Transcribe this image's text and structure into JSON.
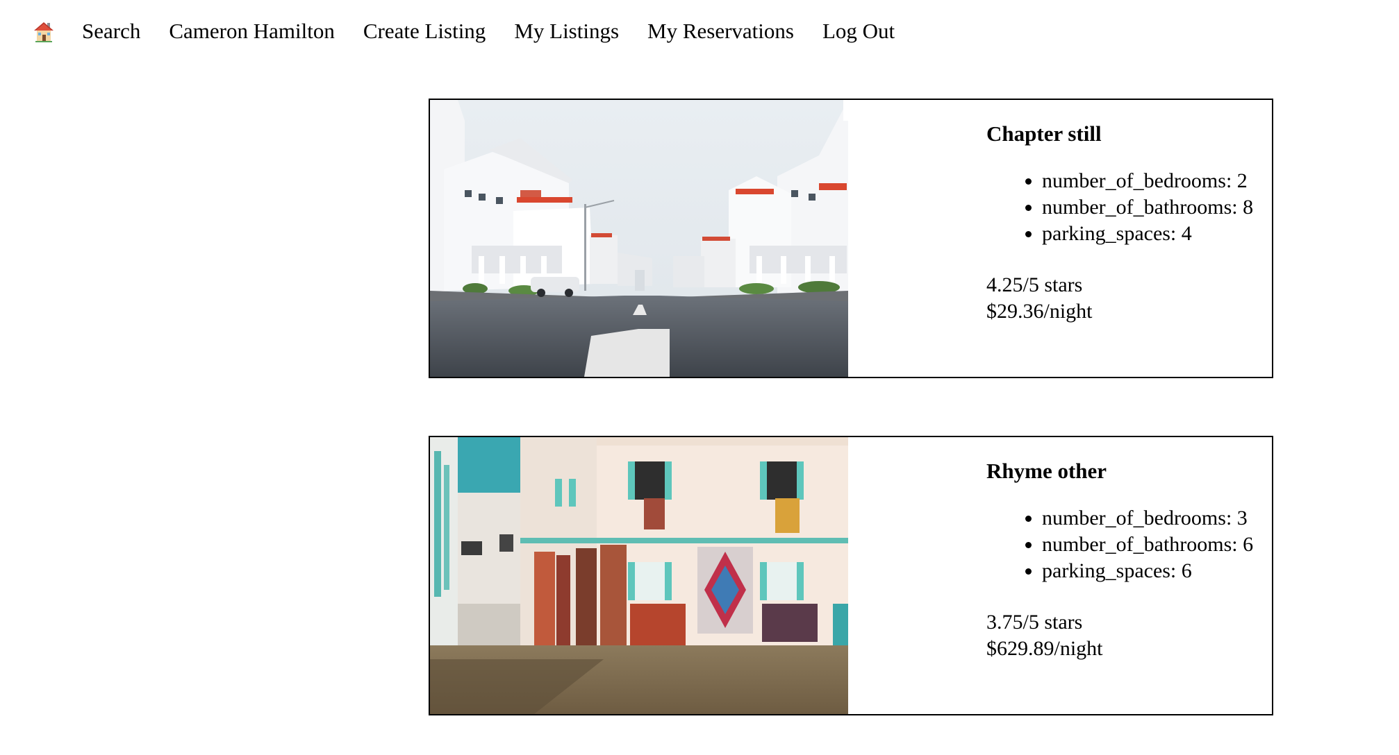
{
  "nav": {
    "home_icon": "house-emoji-icon",
    "items": [
      {
        "label": "Search"
      },
      {
        "label": "Cameron Hamilton"
      },
      {
        "label": "Create Listing"
      },
      {
        "label": "My Listings"
      },
      {
        "label": "My Reservations"
      },
      {
        "label": "Log Out"
      }
    ]
  },
  "listings": [
    {
      "title": "Chapter still",
      "image": "street-with-white-villas-photo",
      "features": [
        "number_of_bedrooms: 2",
        "number_of_bathrooms: 8",
        "parking_spaces: 4"
      ],
      "rating": "4.25/5 stars",
      "price": "$29.36/night"
    },
    {
      "title": "Rhyme other",
      "image": "white-building-with-rugs-photo",
      "features": [
        "number_of_bedrooms: 3",
        "number_of_bathrooms: 6",
        "parking_spaces: 6"
      ],
      "rating": "3.75/5 stars",
      "price": "$629.89/night"
    }
  ]
}
